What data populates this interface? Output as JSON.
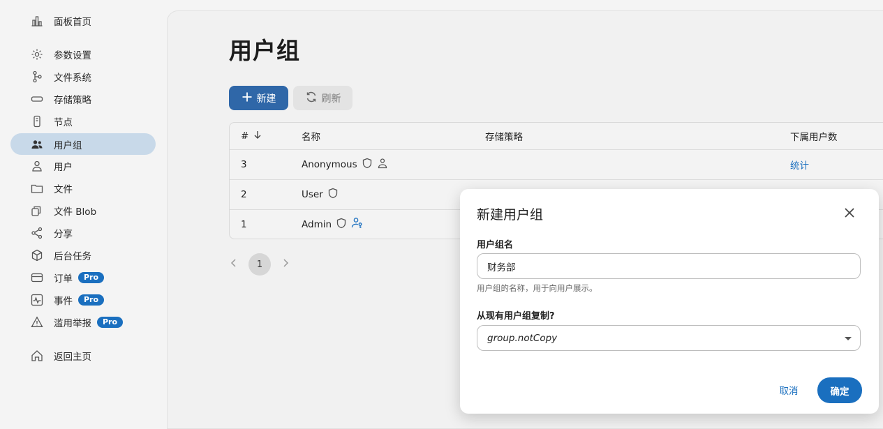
{
  "sidebar": {
    "items": [
      {
        "label": "面板首页",
        "icon": "bar-chart-icon",
        "active": false
      },
      {
        "label": "参数设置",
        "icon": "gear-icon",
        "active": false
      },
      {
        "label": "文件系统",
        "icon": "tree-icon",
        "active": false
      },
      {
        "label": "存储策略",
        "icon": "storage-icon",
        "active": false
      },
      {
        "label": "节点",
        "icon": "node-icon",
        "active": false
      },
      {
        "label": "用户组",
        "icon": "people-icon",
        "active": true
      },
      {
        "label": "用户",
        "icon": "person-icon",
        "active": false
      },
      {
        "label": "文件",
        "icon": "folder-icon",
        "active": false
      },
      {
        "label": "文件 Blob",
        "icon": "blob-icon",
        "active": false
      },
      {
        "label": "分享",
        "icon": "share-icon",
        "active": false
      },
      {
        "label": "后台任务",
        "icon": "task-icon",
        "active": false
      },
      {
        "label": "订单",
        "icon": "card-icon",
        "active": false,
        "badge": "Pro"
      },
      {
        "label": "事件",
        "icon": "pulse-icon",
        "active": false,
        "badge": "Pro"
      },
      {
        "label": "滥用举报",
        "icon": "warning-icon",
        "active": false,
        "badge": "Pro"
      },
      {
        "label": "返回主页",
        "icon": "home-icon",
        "active": false
      }
    ]
  },
  "main": {
    "title": "用户组",
    "new_label": "新建",
    "refresh_label": "刷新",
    "table": {
      "headers": [
        "#",
        "名称",
        "存储策略",
        "下属用户数"
      ],
      "rows": [
        {
          "id": "3",
          "name": "Anonymous",
          "policy": "",
          "users": "统计"
        },
        {
          "id": "2",
          "name": "User",
          "policy": "",
          "users": ""
        },
        {
          "id": "1",
          "name": "Admin",
          "policy": "",
          "users": ""
        }
      ]
    },
    "pagination": {
      "current": "1"
    }
  },
  "dialog": {
    "title": "新建用户组",
    "name_label": "用户组名",
    "name_value": "财务部",
    "name_helper": "用户组的名称，用于向用户展示。",
    "copy_label": "从现有用户组复制?",
    "copy_value": "group.notCopy",
    "cancel_label": "取消",
    "ok_label": "确定"
  },
  "colors": {
    "accent": "#1a6fbf",
    "primary_button": "#2f67a8",
    "active_nav": "#c8d9e9"
  }
}
